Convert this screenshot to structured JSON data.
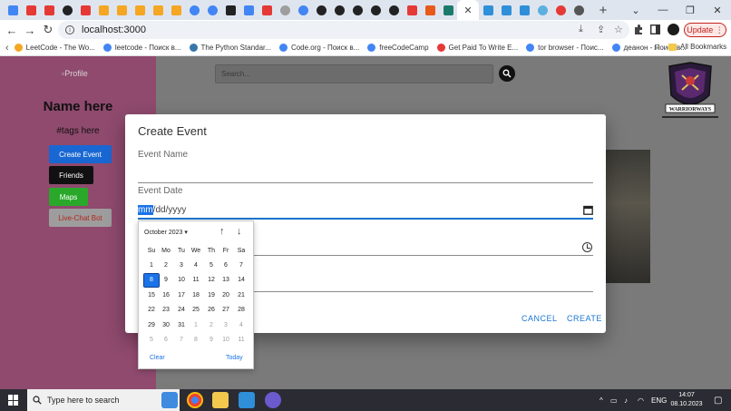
{
  "browser": {
    "tab_close_glyph": "✕",
    "new_tab_glyph": "+",
    "window_controls": [
      "⌄",
      "—",
      "❐",
      "✕"
    ],
    "nav": {
      "back": "←",
      "forward": "→",
      "reload": "↻"
    },
    "address": "localhost:3000",
    "update_label": "Update",
    "colors": {
      "accent": "#1a73e8",
      "update": "#c5221f"
    }
  },
  "bookmarks": [
    {
      "label": "LeetCode - The Wo...",
      "color": "#f5a623"
    },
    {
      "label": "leetcode - Поиск в...",
      "color": "#4285f4"
    },
    {
      "label": "The Python Standar...",
      "color": "#3776ab"
    },
    {
      "label": "Code.org - Поиск в...",
      "color": "#4285f4"
    },
    {
      "label": "freeCodeCamp",
      "color": "#4285f4"
    },
    {
      "label": "Get Paid To Write E...",
      "color": "#e53935"
    },
    {
      "label": "tor browser - Поис...",
      "color": "#4285f4"
    },
    {
      "label": "деанон - Поиск в...",
      "color": "#4285f4"
    }
  ],
  "bookmarks_overflow": "»",
  "all_bookmarks": "All Bookmarks",
  "sidebar": {
    "profile_img_alt": "Profile",
    "name": "Name here",
    "tags": "#tags here",
    "buttons": {
      "create_event": "Create Event",
      "friends": "Friends",
      "maps": "Maps",
      "live_chat": "Live-Chat Bot"
    }
  },
  "search": {
    "placeholder": "Search..."
  },
  "logo_text": "WARRIORWAYS",
  "dialog": {
    "title": "Create Event",
    "event_name_label": "Event Name",
    "event_date_label": "Event Date",
    "date_mm": "mm",
    "date_rest": "/dd/yyyy",
    "cancel": "CANCEL",
    "create": "CREATE"
  },
  "datepicker": {
    "month": "October 2023",
    "caret": "▾",
    "up": "↑",
    "down": "↓",
    "weekdays": [
      "Su",
      "Mo",
      "Tu",
      "We",
      "Th",
      "Fr",
      "Sa"
    ],
    "weeks": [
      [
        "1",
        "2",
        "3",
        "4",
        "5",
        "6",
        "7"
      ],
      [
        "8",
        "9",
        "10",
        "11",
        "12",
        "13",
        "14"
      ],
      [
        "15",
        "16",
        "17",
        "18",
        "19",
        "20",
        "21"
      ],
      [
        "22",
        "23",
        "24",
        "25",
        "26",
        "27",
        "28"
      ],
      [
        "29",
        "30",
        "31",
        "1",
        "2",
        "3",
        "4"
      ],
      [
        "5",
        "6",
        "7",
        "8",
        "9",
        "10",
        "11"
      ]
    ],
    "selected": "8",
    "clear": "Clear",
    "today": "Today"
  },
  "taskbar": {
    "search_placeholder": "Type here to search",
    "tray_caret": "^",
    "language": "ENG",
    "time": "14:07",
    "date": "08.10.2023"
  }
}
